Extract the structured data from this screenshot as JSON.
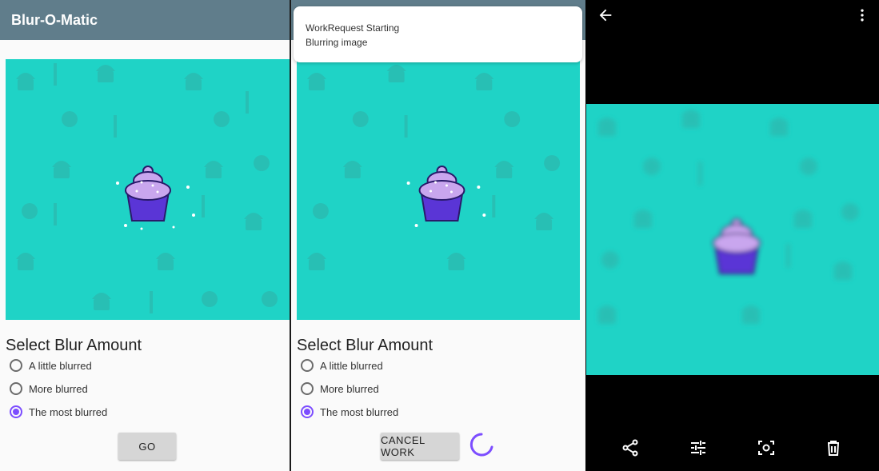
{
  "app": {
    "title": "Blur-O-Matic"
  },
  "blur_section": {
    "title": "Select Blur Amount",
    "options": [
      "A little blurred",
      "More blurred",
      "The most blurred"
    ],
    "selected_index": 2
  },
  "buttons": {
    "go": "GO",
    "cancel": "CANCEL WORK"
  },
  "notification": {
    "title": "WorkRequest Starting",
    "text": "Blurring image"
  },
  "colors": {
    "appbar": "#607d8b",
    "accent": "#7c4dff",
    "image_bg": "#1fd3c6"
  },
  "viewer": {
    "icons": [
      "back-arrow-icon",
      "overflow-menu-icon",
      "share-icon",
      "edit-icon",
      "lens-icon",
      "delete-icon"
    ]
  }
}
